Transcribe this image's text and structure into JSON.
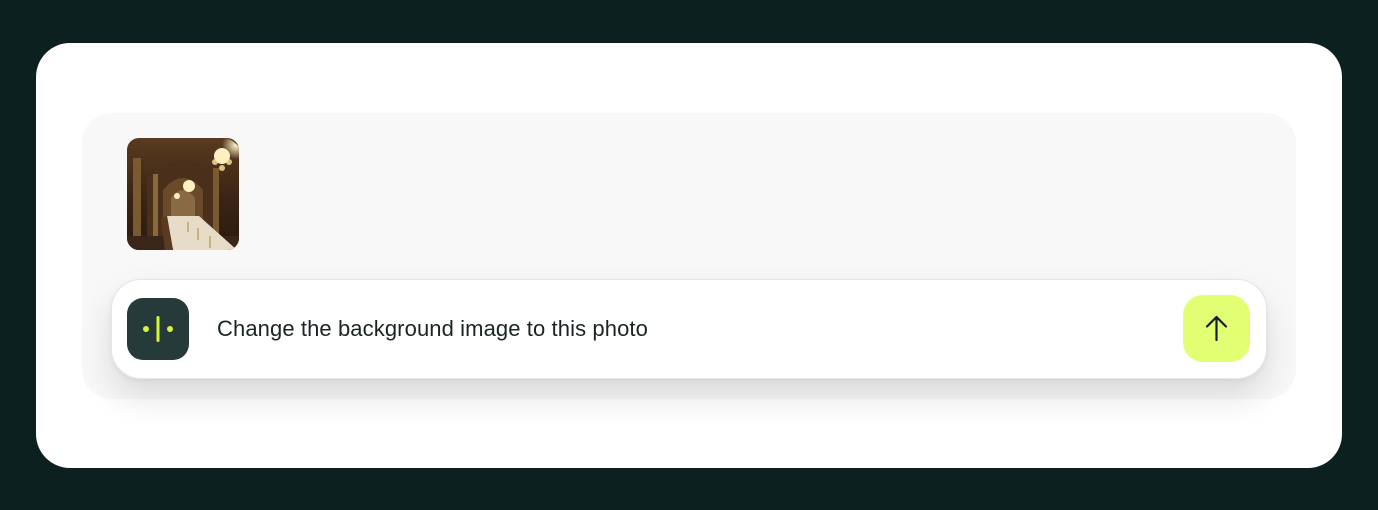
{
  "composer": {
    "attachment": {
      "kind": "image-thumbnail",
      "depicts": "ornate hall with chandeliers and long dining table"
    },
    "assistant_icon": "assistant-logo-icon",
    "prompt_text": "Change the background image to this photo",
    "send_icon": "arrow-up-icon"
  },
  "colors": {
    "page_background": "#0c2020",
    "card_background": "#ffffff",
    "composer_background": "#f8f8f8",
    "assistant_badge": "#263a3a",
    "assistant_accent": "#d4f53c",
    "send_button": "#e2ff73",
    "text": "#1b2424"
  }
}
